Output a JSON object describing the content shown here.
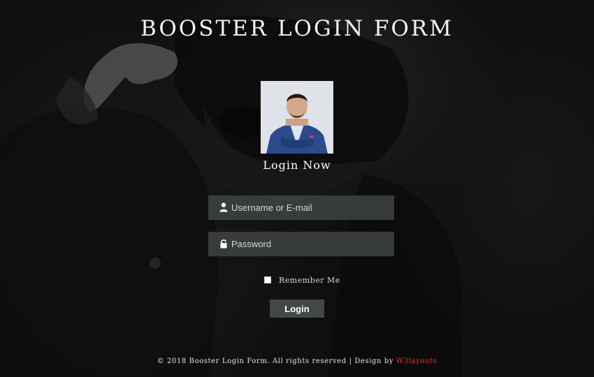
{
  "page": {
    "title": "BOOSTER LOGIN FORM",
    "subtitle": "Login Now"
  },
  "form": {
    "username_placeholder": "Username or E-mail",
    "username_value": "",
    "password_placeholder": "Password",
    "password_value": "",
    "remember_label": "Remember Me",
    "remember_checked": false,
    "login_label": "Login"
  },
  "footer": {
    "text": "© 2018 Booster Login Form. All rights reserved | Design by",
    "link_label": "W3layouts",
    "link_color": "#e53935"
  },
  "icons": {
    "username": "user-icon",
    "password": "lock-icon"
  },
  "colors": {
    "background": "#1b1b1b",
    "field_background": "#464c4c",
    "button_background": "#414848",
    "text": "#ffffff"
  }
}
